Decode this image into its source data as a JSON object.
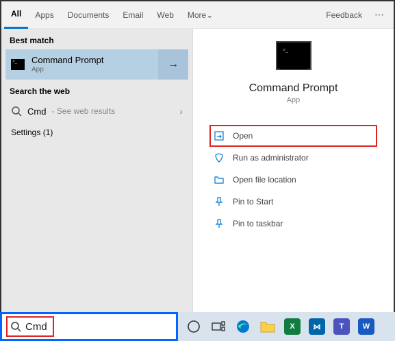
{
  "tabs": {
    "all": "All",
    "apps": "Apps",
    "documents": "Documents",
    "email": "Email",
    "web": "Web",
    "more": "More",
    "feedback": "Feedback"
  },
  "left": {
    "best_match_label": "Best match",
    "best_title": "Command Prompt",
    "best_sub": "App",
    "search_web_label": "Search the web",
    "web_item": "Cmd",
    "web_item_sub": "- See web results",
    "settings_label": "Settings (1)"
  },
  "preview": {
    "title": "Command Prompt",
    "sub": "App"
  },
  "actions": {
    "open": "Open",
    "run_admin": "Run as administrator",
    "open_loc": "Open file location",
    "pin_start": "Pin to Start",
    "pin_taskbar": "Pin to taskbar"
  },
  "search": {
    "value": "Cmd"
  }
}
